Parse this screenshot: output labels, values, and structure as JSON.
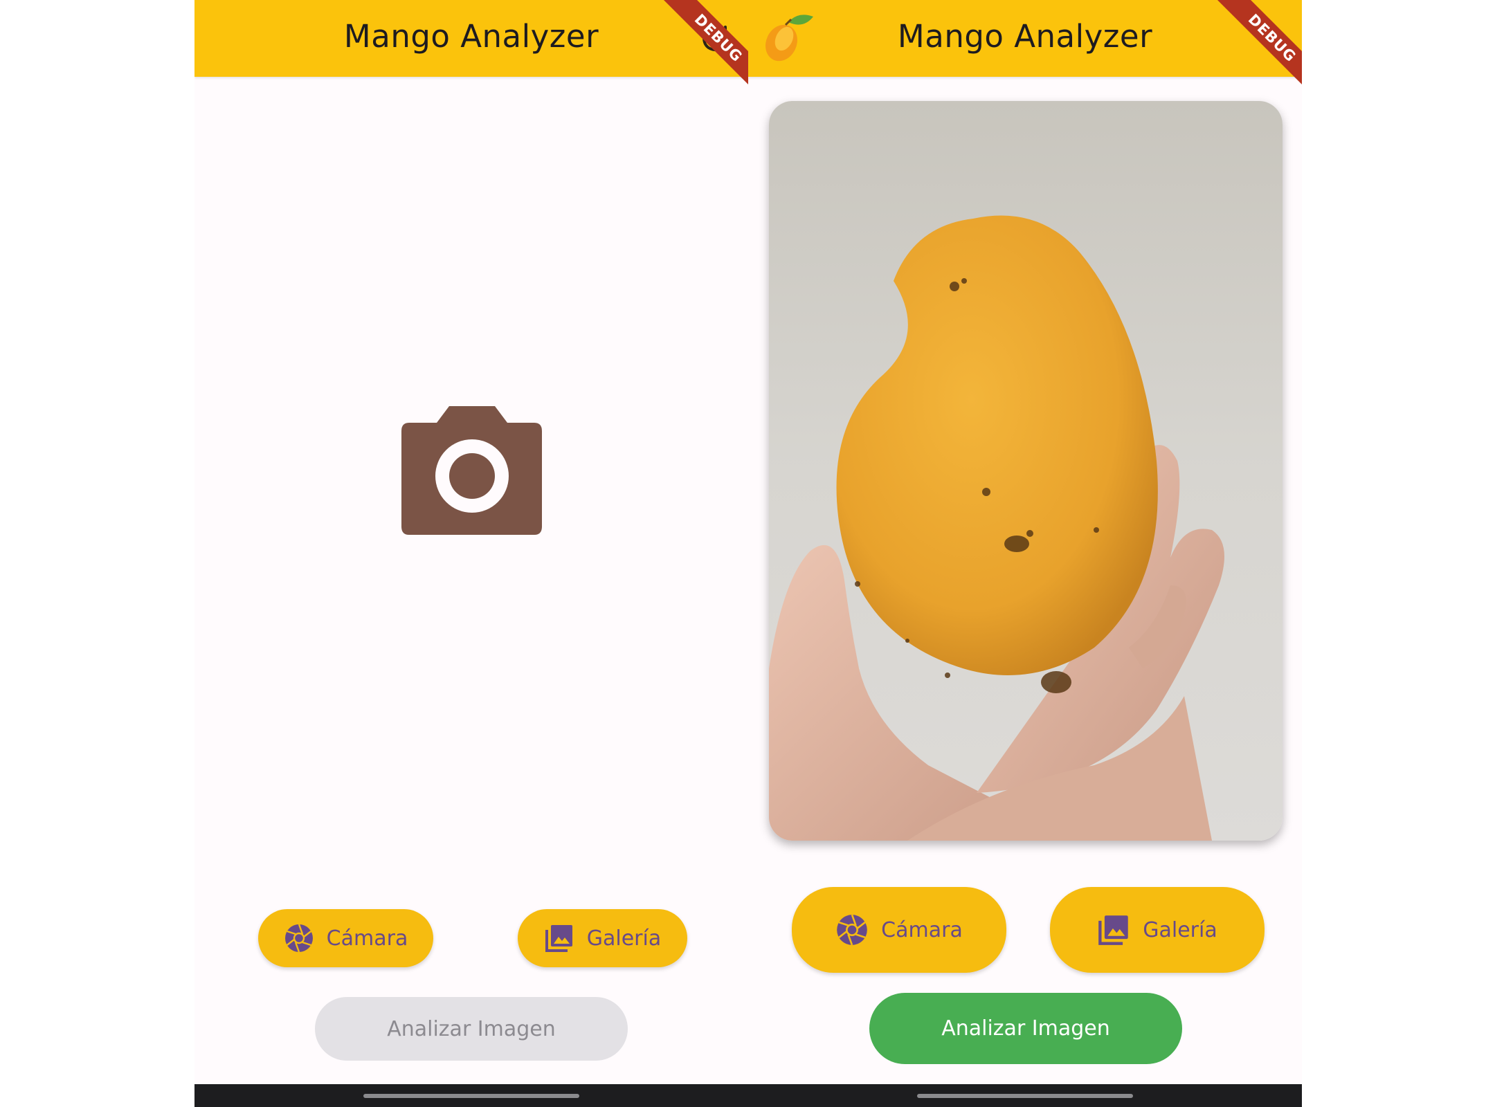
{
  "left_screen": {
    "appbar": {
      "title": "Mango Analyzer",
      "debug_banner": "DEBUG"
    },
    "placeholder_icon": "camera-icon",
    "buttons": {
      "camera_label": "Cámara",
      "gallery_label": "Galería",
      "analyze_label": "Analizar Imagen"
    },
    "analyze_state": "disabled"
  },
  "right_screen": {
    "appbar": {
      "title": "Mango Analyzer",
      "debug_banner": "DEBUG"
    },
    "logo_icon": "mango-icon",
    "selected_image": "photo of a hand holding a yellow mango",
    "buttons": {
      "camera_label": "Cámara",
      "gallery_label": "Galería",
      "analyze_label": "Analizar Imagen"
    },
    "analyze_state": "enabled"
  },
  "colors": {
    "appbar": "#fbc30c",
    "button": "#f6bc10",
    "button_text": "#674a8a",
    "analyze_enabled": "#48ae52",
    "analyze_disabled": "#e3e1e5",
    "debug_banner": "#b5341f",
    "placeholder_icon": "#7b5446"
  }
}
